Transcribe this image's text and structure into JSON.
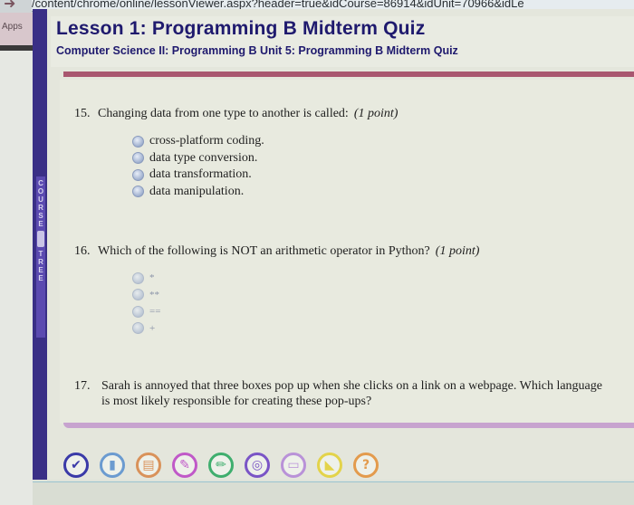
{
  "browser": {
    "url": "/content/chrome/online/lessonViewer.aspx?header=true&idCourse=86914&idUnit=70966&idLe",
    "apps_label": "Apps"
  },
  "header": {
    "title": "Lesson 1: Programming B Midterm Quiz",
    "breadcrumb": "Computer Science II: Programming B  Unit 5: Programming B Midterm Quiz"
  },
  "sidebar": {
    "course_tree_letters": [
      "C",
      "O",
      "U",
      "R",
      "S",
      "E",
      "T",
      "R",
      "E",
      "E"
    ]
  },
  "questions": [
    {
      "number": "15.",
      "text": "Changing data from one type to another is called:",
      "points": "(1 point)",
      "options": [
        "cross-platform coding.",
        "data type conversion.",
        "data transformation.",
        "data manipulation."
      ]
    },
    {
      "number": "16.",
      "text": "Which of the following is NOT an arithmetic operator in Python?",
      "points": "(1 point)",
      "options": [
        "*",
        "**",
        "==",
        "+"
      ]
    },
    {
      "number": "17.",
      "text": "Sarah is annoyed that three boxes pop up when she clicks on a link on a webpage. Which language is most likely responsible for creating these pop-ups?",
      "points": ""
    }
  ],
  "toolbar": [
    {
      "name": "check-icon",
      "glyph": "✔",
      "color": "#3a3aa8"
    },
    {
      "name": "notebook-icon",
      "glyph": "▮",
      "color": "#6b9bd0"
    },
    {
      "name": "flashcards-icon",
      "glyph": "▤",
      "color": "#d9925a"
    },
    {
      "name": "pushpin-icon",
      "glyph": "✎",
      "color": "#c059c8"
    },
    {
      "name": "pencil-icon",
      "glyph": "✏",
      "color": "#3fae6e"
    },
    {
      "name": "target-icon",
      "glyph": "◎",
      "color": "#7a55c6"
    },
    {
      "name": "keyboard-icon",
      "glyph": "▭",
      "color": "#b992d8"
    },
    {
      "name": "shoe-icon",
      "glyph": "◣",
      "color": "#e3d34a"
    },
    {
      "name": "help-icon",
      "glyph": "?",
      "color": "#e39b4d"
    }
  ]
}
